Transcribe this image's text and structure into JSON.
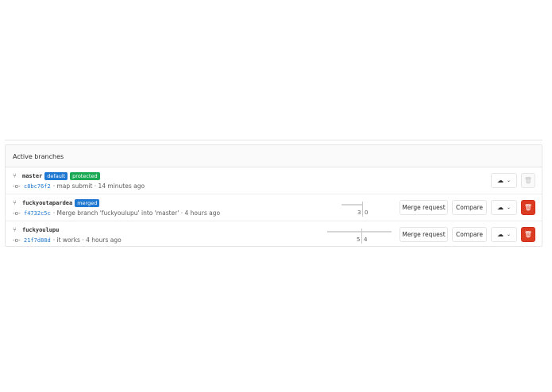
{
  "panel": {
    "title": "Active branches"
  },
  "branches": [
    {
      "name": "master",
      "badges": [
        "default",
        "protected"
      ],
      "sha": "c8bc76f2",
      "message": "map submit",
      "time": "14 minutes ago",
      "behind": null,
      "ahead": null,
      "merge_request_label": null,
      "compare_label": null,
      "delete_enabled": false
    },
    {
      "name": "fuckyoutapardea",
      "badges": [
        "merged"
      ],
      "sha": "f4732c5c",
      "message": "Merge branch 'fuckyoulupu' into 'master'",
      "time": "4 hours ago",
      "behind": "3",
      "ahead": "0",
      "merge_request_label": "Merge request",
      "compare_label": "Compare",
      "delete_enabled": true
    },
    {
      "name": "fuckyoulupu",
      "badges": [],
      "sha": "21f7d88d",
      "message": "it works",
      "time": "4 hours ago",
      "behind": "5",
      "ahead": "4",
      "merge_request_label": "Merge request",
      "compare_label": "Compare",
      "delete_enabled": true
    }
  ],
  "separators": {
    "middot": "·"
  },
  "icons": {
    "branch": "fork-icon",
    "commit": "commit-icon",
    "download": "cloud-download-icon",
    "dropdown": "chevron-down-icon",
    "delete": "trash-icon"
  },
  "colors": {
    "link": "#1f78d1",
    "default_badge": "#1f78d1",
    "protected_badge": "#1aaa55",
    "merged_badge": "#1f78d1",
    "danger": "#db3b21"
  }
}
